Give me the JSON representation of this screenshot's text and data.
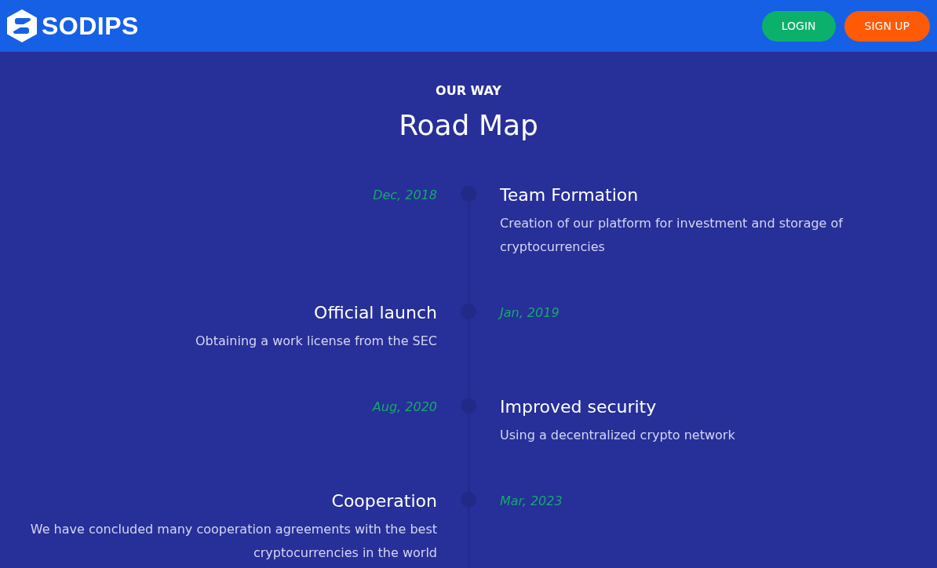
{
  "header": {
    "logo_text": "SODIPS",
    "buttons": [
      {
        "label": "LOGIN",
        "kind": "login"
      },
      {
        "label": "SIGN UP",
        "kind": "signup"
      }
    ]
  },
  "section": {
    "eyebrow": "OUR WAY",
    "title": "Road Map"
  },
  "timeline": [
    {
      "kind": "right",
      "date": "Dec, 2018",
      "title": "Team Formation",
      "description": "Creation of our platform for investment and storage of cryptocurrencies"
    },
    {
      "kind": "left",
      "date": "Jan, 2019",
      "title": "Official launch",
      "description": "Obtaining a work license from the SEC"
    },
    {
      "kind": "right",
      "date": "Aug, 2020",
      "title": "Improved security",
      "description": "Using a decentralized crypto network"
    },
    {
      "kind": "left",
      "date": "Mar, 2023",
      "title": "Cooperation",
      "description": "We have concluded many cooperation agreements with the best cryptocurrencies in the world"
    }
  ]
}
